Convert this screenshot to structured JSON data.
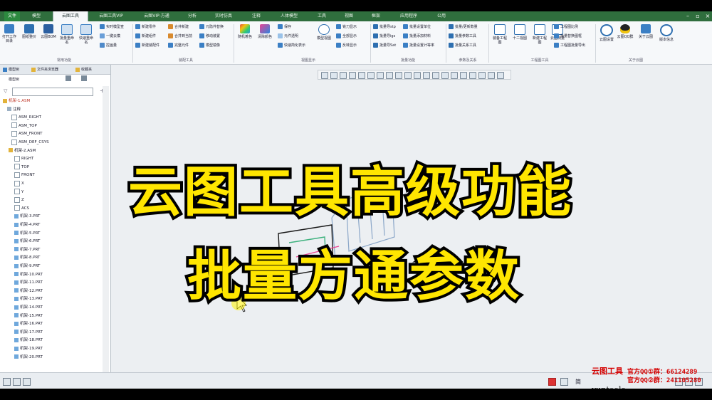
{
  "tabs": [
    "文件",
    "模型",
    "云图工具",
    "云图工具VIP",
    "云图VIP-方通",
    "分析",
    "实时仿真",
    "注释",
    "人体模型",
    "工具",
    "视图",
    "框架",
    "应用程序",
    "公用"
  ],
  "active_tab": "云图工具",
  "ribbon": {
    "common": {
      "buttons": [
        "打开工作目录",
        "图纸整价",
        "云图BOM",
        "批量重命名",
        "快速重命名"
      ],
      "small": [
        "实时模型查",
        "一键云模",
        "控画量"
      ],
      "label": "常用功能"
    },
    "assembly": {
      "small": [
        "新建零件",
        "新建组件",
        "新建装配件",
        "合并新建",
        "合并到当前",
        "完整元件",
        "元隐件替换",
        "移动装置",
        "模型镜像"
      ],
      "label": "装配工具"
    },
    "view": {
      "buttons": [
        "随机着色",
        "清除颜色",
        "模型视图"
      ],
      "small": [
        "保存",
        "元件透明",
        "快速简化表示",
        "铣刀显示",
        "全部显示",
        "反转显示"
      ],
      "label": "视图显示"
    },
    "batch": {
      "small": [
        "批量导stp",
        "批量导igs",
        "批量导Sat",
        "批量设置单位",
        "批量添加材料",
        "批量设置计等率"
      ],
      "label": "批量功能"
    },
    "params": {
      "small": [
        "批量/更新数量",
        "批量参数工具",
        "批量关系工具"
      ],
      "label": "参数及关系"
    },
    "drawing": {
      "buttons": [
        "装备工程图",
        "十二视图",
        "新建工程图",
        "云图测量"
      ],
      "small": [
        "工程图比例",
        "批量替换图框",
        "工程图批量导出"
      ],
      "label": "工程图工具"
    },
    "about": {
      "buttons": [
        "云图设置",
        "云图QQ群",
        "关于云图",
        "版本信息"
      ],
      "label": "关于云图"
    }
  },
  "panel": {
    "tabs": [
      "模型树",
      "文件夹浏览器",
      "收藏夹"
    ],
    "toolbar_label": "模型树",
    "tree": [
      "机架-1.ASM",
      "注释",
      "ASM_RIGHT",
      "ASM_TOP",
      "ASM_FRONT",
      "ASM_DEF_CSYS",
      "机架-2.ASM",
      "RIGHT",
      "TOP",
      "FRONT",
      "X",
      "Y",
      "Z",
      "ACS",
      "机架-3.PRT",
      "机架-4.PRT",
      "机架-5.PRT",
      "机架-6.PRT",
      "机架-7.PRT",
      "机架-8.PRT",
      "机架-9.PRT",
      "机架-10.PRT",
      "机架-11.PRT",
      "机架-12.PRT",
      "机架-13.PRT",
      "机架-14.PRT",
      "机架-15.PRT",
      "机架-16.PRT",
      "机架-17.PRT",
      "机架-18.PRT",
      "机架-19.PRT",
      "机架-20.PRT"
    ]
  },
  "overlay": {
    "line1": "云图工具高级功能",
    "line2": "批量方通参数"
  },
  "status": {
    "brand": "云图工具",
    "qq1": "官方QQ①群：66124289",
    "qq2": "官方QQ②群：241105280",
    "yt": "yuntools",
    "lang": "简"
  },
  "colors": {
    "tab_bar": "#2f6e3d",
    "title_yellow": "#ffe600",
    "brand_red": "#d40000"
  }
}
